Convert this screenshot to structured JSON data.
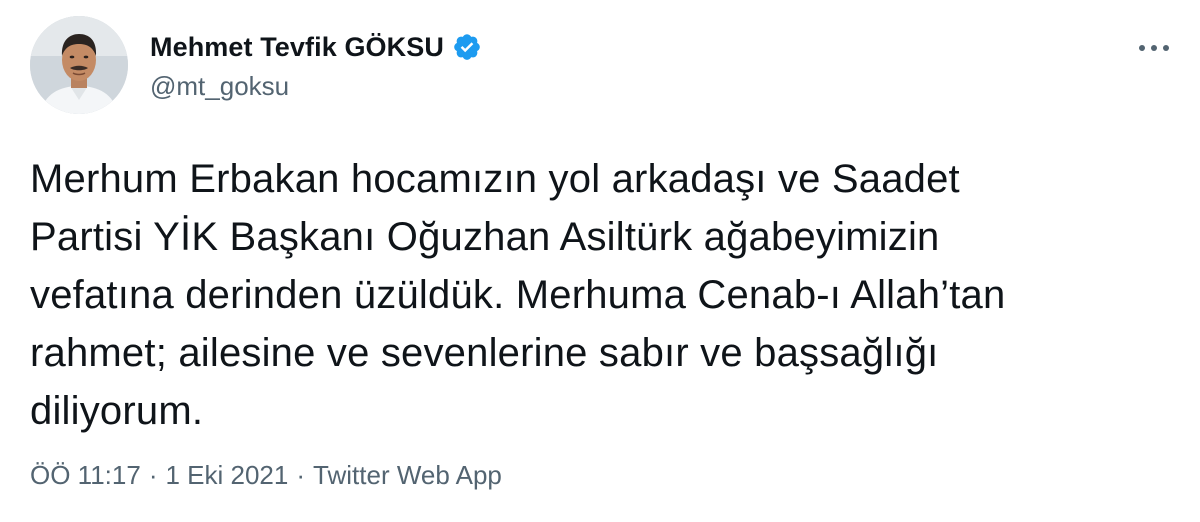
{
  "tweet": {
    "author": {
      "display_name": "Mehmet Tevfik GÖKSU",
      "handle": "@mt_goksu",
      "verified": true,
      "avatar_icon": "avatar-profile-photo"
    },
    "text": "Merhum Erbakan hocamızın yol arkadaşı ve Saadet\nPartisi YİK Başkanı Oğuzhan Asiltürk ağabeyimizin\nvefatına derinden üzüldük. Merhuma Cenab-ı Allah’tan\nrahmet; ailesine ve sevenlerine sabır ve başsağlığı\ndiliyorum.",
    "time": "ÖÖ 11:17",
    "separator": "·",
    "date": "1 Eki 2021",
    "source": "Twitter Web App"
  },
  "icons": {
    "verified": "verified-badge-icon",
    "more": "more-options-icon"
  },
  "colors": {
    "text_primary": "#0f1419",
    "text_secondary": "#536471",
    "verified_blue": "#1d9bf0",
    "background": "#ffffff"
  }
}
